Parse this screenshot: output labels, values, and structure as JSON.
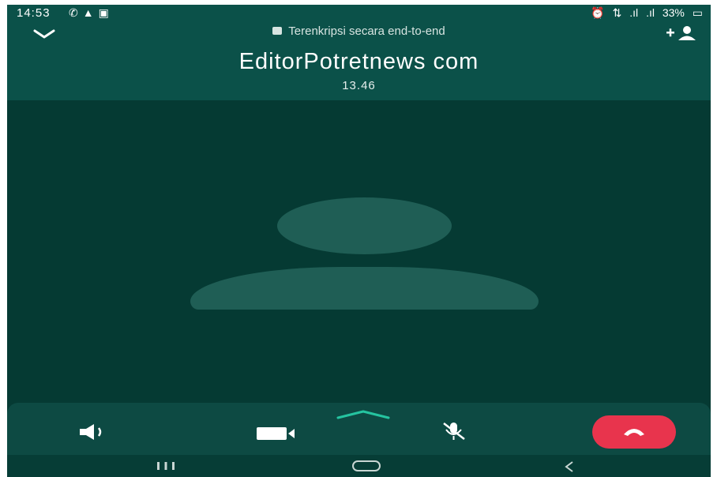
{
  "status_bar": {
    "time": "14:53",
    "left_icons": [
      "phone-icon",
      "warning-icon",
      "gallery-icon"
    ],
    "right_icons": [
      "alarm-icon",
      "4g-icon",
      "signal-icon",
      "signal-icon"
    ],
    "battery": "33%"
  },
  "call": {
    "encryption_text": "Terenkripsi secara end-to-end",
    "contact_name": "EditorPotretnews com",
    "duration": "13.46"
  },
  "controls": {
    "items": [
      "speaker-icon",
      "video-camera-icon",
      "microphone-off-icon",
      "end-call-icon"
    ],
    "end_call_color": "#e8344d"
  },
  "colors": {
    "header": "#0b5149",
    "background": "#053a33",
    "avatar": "#1f5e55",
    "accent": "#25c4a0"
  }
}
